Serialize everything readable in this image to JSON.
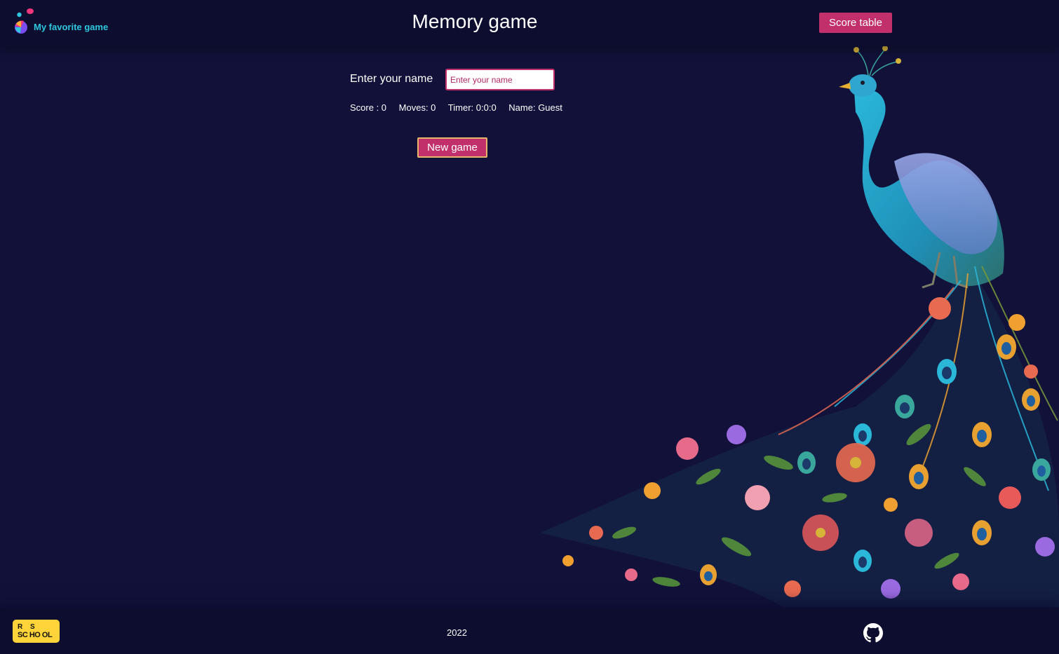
{
  "header": {
    "logo_text": "My favorite game",
    "title": "Memory game",
    "score_table_label": "Score table"
  },
  "form": {
    "name_label": "Enter your name",
    "name_placeholder": "Enter your name",
    "name_value": ""
  },
  "stats": {
    "score": "Score : 0",
    "moves": "Moves: 0",
    "timer": "Timer: 0:0:0",
    "name": "Name: Guest"
  },
  "new_game_label": "New game",
  "footer": {
    "school_logo_text": "RS SCHOOL",
    "year": "2022",
    "github_icon": "github-icon"
  },
  "colors": {
    "background": "#11113a",
    "header_bg": "#0d0d30",
    "accent": "#c2306c",
    "logo_text": "#2ec7dc",
    "school_badge": "#ffd43b"
  }
}
